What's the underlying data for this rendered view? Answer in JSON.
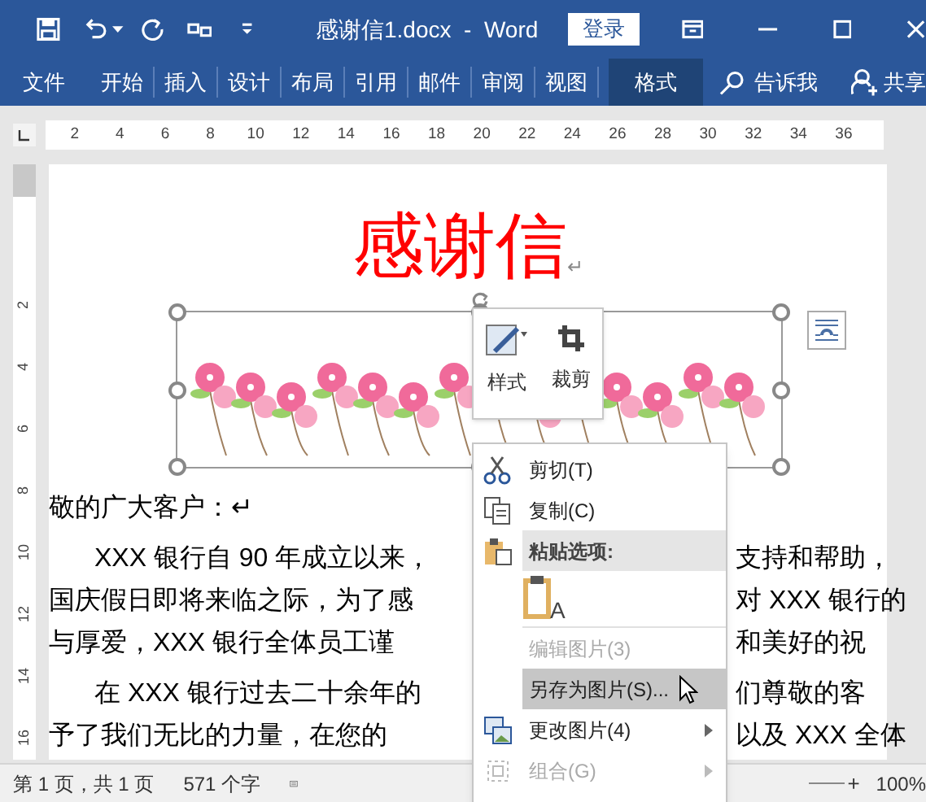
{
  "title_bar": {
    "title": "感谢信1.docx  -  Word",
    "sign_in": "登录"
  },
  "ribbon_tabs": [
    {
      "label": "文件",
      "selected": false
    },
    {
      "label": "开始",
      "selected": false
    },
    {
      "label": "插入",
      "selected": false
    },
    {
      "label": "设计",
      "selected": false
    },
    {
      "label": "布局",
      "selected": false
    },
    {
      "label": "引用",
      "selected": false
    },
    {
      "label": "邮件",
      "selected": false
    },
    {
      "label": "审阅",
      "selected": false
    },
    {
      "label": "视图",
      "selected": false
    },
    {
      "label": "格式",
      "selected": true
    }
  ],
  "tell_me": "告诉我",
  "share": "共享",
  "ruler": {
    "horizontal": [
      "2",
      "4",
      "6",
      "8",
      "10",
      "12",
      "14",
      "16",
      "18",
      "20",
      "22",
      "24",
      "26",
      "28",
      "30",
      "32",
      "34",
      "36"
    ],
    "vertical": [
      "2",
      "4",
      "6",
      "8",
      "10",
      "12",
      "14",
      "16"
    ]
  },
  "document": {
    "heading": "感谢信",
    "heading_mark": "↵",
    "lines": [
      {
        "left": "敬的广大客户：↵",
        "indent": false
      },
      {
        "left": "XXX 银行自 90 年成立以来，",
        "right": "支持和帮助，",
        "indent": true
      },
      {
        "left": "国庆假日即将来临之际，为了感",
        "right": "对 XXX 银行的",
        "indent": false
      },
      {
        "left": "与厚爱，XXX 银行全体员工谨",
        "right": "和美好的祝",
        "indent": false
      },
      {
        "left": "在 XXX 银行过去二十余年的",
        "right": "们尊敬的客",
        "indent": true
      },
      {
        "left": "予了我们无比的力量，在您的",
        "right": "以及 XXX 全体",
        "indent": false
      }
    ]
  },
  "mini_toolbar": [
    {
      "label": "样式",
      "kind": "style"
    },
    {
      "label": "裁剪",
      "kind": "crop"
    }
  ],
  "context_menu": [
    {
      "kind": "item",
      "label": "剪切(T)",
      "disabled": false,
      "selected": false,
      "submenu": false
    },
    {
      "kind": "item",
      "label": "复制(C)",
      "disabled": false,
      "selected": false,
      "submenu": false
    },
    {
      "kind": "header",
      "label": "粘贴选项:"
    },
    {
      "kind": "paste_options",
      "letter": "A"
    },
    {
      "kind": "item",
      "label": "编辑图片(3)",
      "disabled": true,
      "selected": false,
      "submenu": false
    },
    {
      "kind": "item",
      "label": "另存为图片(S)...",
      "disabled": false,
      "selected": true,
      "submenu": false
    },
    {
      "kind": "item",
      "label": "更改图片(4)",
      "disabled": false,
      "selected": false,
      "submenu": true
    },
    {
      "kind": "item",
      "label": "组合(G)",
      "disabled": true,
      "selected": false,
      "submenu": true
    }
  ],
  "status_bar": {
    "page": "第 1 页，共 1 页",
    "words": "571 个字",
    "zoom_plus": "+",
    "zoom": "100%"
  }
}
